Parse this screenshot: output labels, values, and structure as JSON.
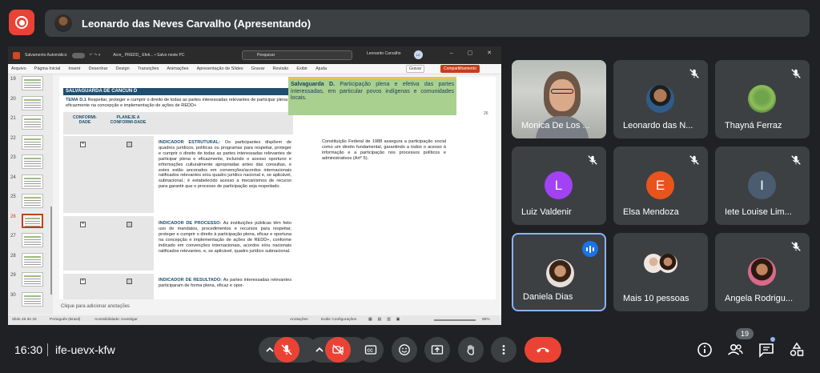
{
  "header": {
    "presenter_title": "Leonardo das Neves Carvalho (Apresentando)"
  },
  "presentation": {
    "app_title_bar": {
      "autosave": "Salvamento Automático",
      "filename": "Acre_ PREDD_ Efeti... • Salvo neste PC",
      "search_placeholder": "Pesquisar",
      "user": "Leonardo Carvalho",
      "user_initials": "LC"
    },
    "menu": [
      "Arquivo",
      "Página Inicial",
      "Inserir",
      "Desenhar",
      "Design",
      "Transições",
      "Animações",
      "Apresentação de Slides",
      "Gravar",
      "Revisão",
      "Exibir",
      "Ajuda"
    ],
    "gravar_btn": "Gravar",
    "share_btn": "Compartilhamento",
    "thumbnails": [
      "19",
      "20",
      "21",
      "22",
      "23",
      "24",
      "25",
      "26",
      "27",
      "28",
      "29",
      "30"
    ],
    "current_slide_index": 7,
    "slide": {
      "doc_title": "SALVAGUARDA DE CANCÚN D",
      "tema_label": "TEMA D.1",
      "tema_text": " Respeitar, proteger e cumprir o direito de todas as partes interessadas relevantes de participar plena e eficazmente na concepção e implementação de ações de REDD+",
      "col_conformidade": "CONFORMI-DADE",
      "col_planeje": "PLANEJE A CONFORMI-DADE",
      "ind1_label": "INDICADOR ESTRUTURAL:",
      "ind1_text": " Os participantes dispõem de quadros jurídicos, políticas ou programas para respeitar, proteger e cumprir o direito de todas as partes interessadas relevantes de participar plena e eficazmente, incluindo o acesso oportuno e informações culturalmente apropriadas antes das consultas, e estes estão ancorados em convenções/acordos internacionais ratificados relevantes e/ou quadro jurídico nacional e, se aplicável, subnacional.; é estabelecido acesso a mecanismos de recurso para garantir que o processo de participação seja respeitado.",
      "ind2_label": "INDICADOR DE PROCESSO:",
      "ind2_text": " As instituições públicas têm feito uso de mandatos, procedimentos e recursos para respeitar, proteger e cumprir o direito à participação plena, eficaz e oportuna na concepção e implementação de ações de REDD+, conforme indicado em convenções internacionais, acordos e/ou nacionais ratificados relevantes. e, se aplicável, quadro jurídico subnacional.",
      "ind3_label": "INDICADOR DE RESULTADO:",
      "ind3_text": " As partes interessadas relevantes participaram de forma plena, eficaz e opor-",
      "green_label": "Salvaguarda D.",
      "green_text": " Participação plena e efetiva das partes interessadas, em particular povos indígenas e comunidades locais.",
      "page_number": "26",
      "note_text": "Constituição Federal de 1988 assegura a participação social como um direito fundamental, garantindo a todos o acesso à informação e a participação nos processos políticos e administrativos (Art° 5)."
    },
    "notes_placeholder": "Clique para adicionar anotações",
    "status": {
      "slide_of": "Slide 26 de 32",
      "language": "Português (Brasil)",
      "accessibility": "Acessibilidade: investigar",
      "notes": "Anotações",
      "display": "Exibir Configurações",
      "zoom": "90%"
    }
  },
  "participants": [
    {
      "name": "Monica De Los ...",
      "type": "video"
    },
    {
      "name": "Leonardo das N...",
      "type": "photo",
      "muted": true
    },
    {
      "name": "Thayná Ferraz",
      "type": "photo",
      "muted": true
    },
    {
      "name": "Luiz Valdenir",
      "type": "letter",
      "letter": "L",
      "color": "#a142f4",
      "muted": true
    },
    {
      "name": "Elsa Mendoza",
      "type": "letter",
      "letter": "E",
      "color": "#e8541d",
      "muted": true
    },
    {
      "name": "Iete Louise Lim...",
      "type": "letter",
      "letter": "I",
      "color": "#4a5d70",
      "muted": true
    },
    {
      "name": "Daniela Dias",
      "type": "photo",
      "speaking": true
    },
    {
      "name": "Mais 10 pessoas",
      "type": "group"
    },
    {
      "name": "Angela Rodrigu...",
      "type": "photo",
      "muted": true
    }
  ],
  "bottom_bar": {
    "time": "16:30",
    "meeting_code": "ife-uevx-kfw",
    "people_count": "19"
  },
  "colors": {
    "background": "#202124",
    "tile": "#3c4043",
    "red": "#ea4335",
    "blue": "#1a73e8"
  }
}
